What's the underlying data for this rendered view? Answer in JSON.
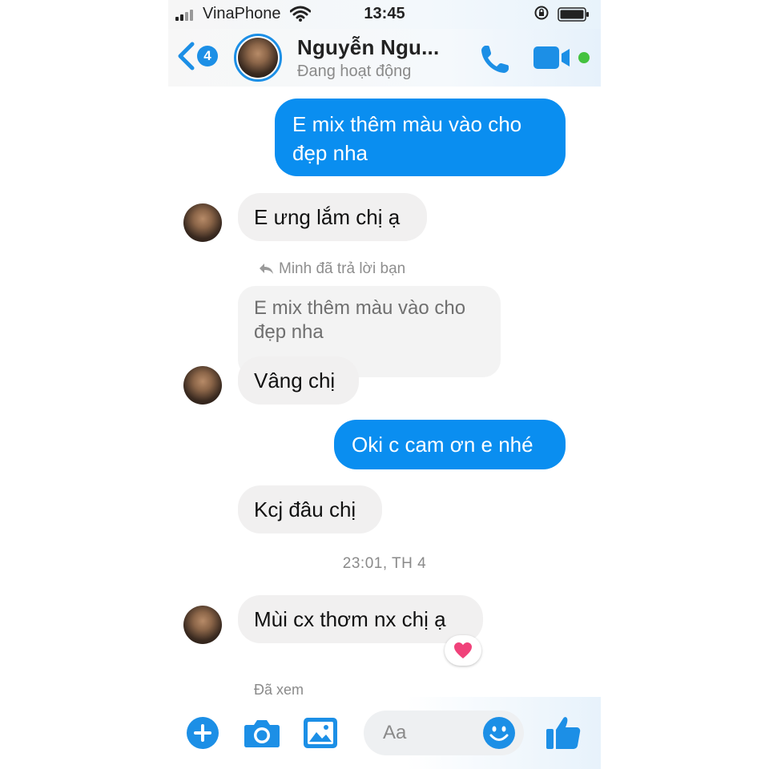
{
  "status_bar": {
    "carrier": "VinaPhone",
    "time": "13:45"
  },
  "header": {
    "back_count": "4",
    "contact_name": "Nguyễn Ngu...",
    "contact_status": "Đang hoạt động"
  },
  "messages": [
    {
      "from": "me",
      "text": "E mix thêm màu vào cho đẹp nha"
    },
    {
      "from": "contact",
      "text": "E ưng lắm chị ạ"
    },
    {
      "from": "contact",
      "reply_note": "Minh đã trả lời bạn",
      "quoted": "E mix thêm màu vào cho đẹp nha",
      "text": "Vâng chị"
    },
    {
      "from": "me",
      "text": "Oki c cam ơn e nhé"
    },
    {
      "from": "contact",
      "text": "Kcj đâu chị"
    },
    {
      "from": "contact",
      "text": "Mùi cx thơm nx chị ạ",
      "reaction": "heart"
    }
  ],
  "timestamp": "23:01, TH 4",
  "seen_text": "Đã xem",
  "composer": {
    "placeholder": "Aa"
  },
  "colors": {
    "accent": "#0a8ef0",
    "icon_blue": "#1c8fe6",
    "active_green": "#44c23f",
    "heart_pink": "#f0427a"
  }
}
